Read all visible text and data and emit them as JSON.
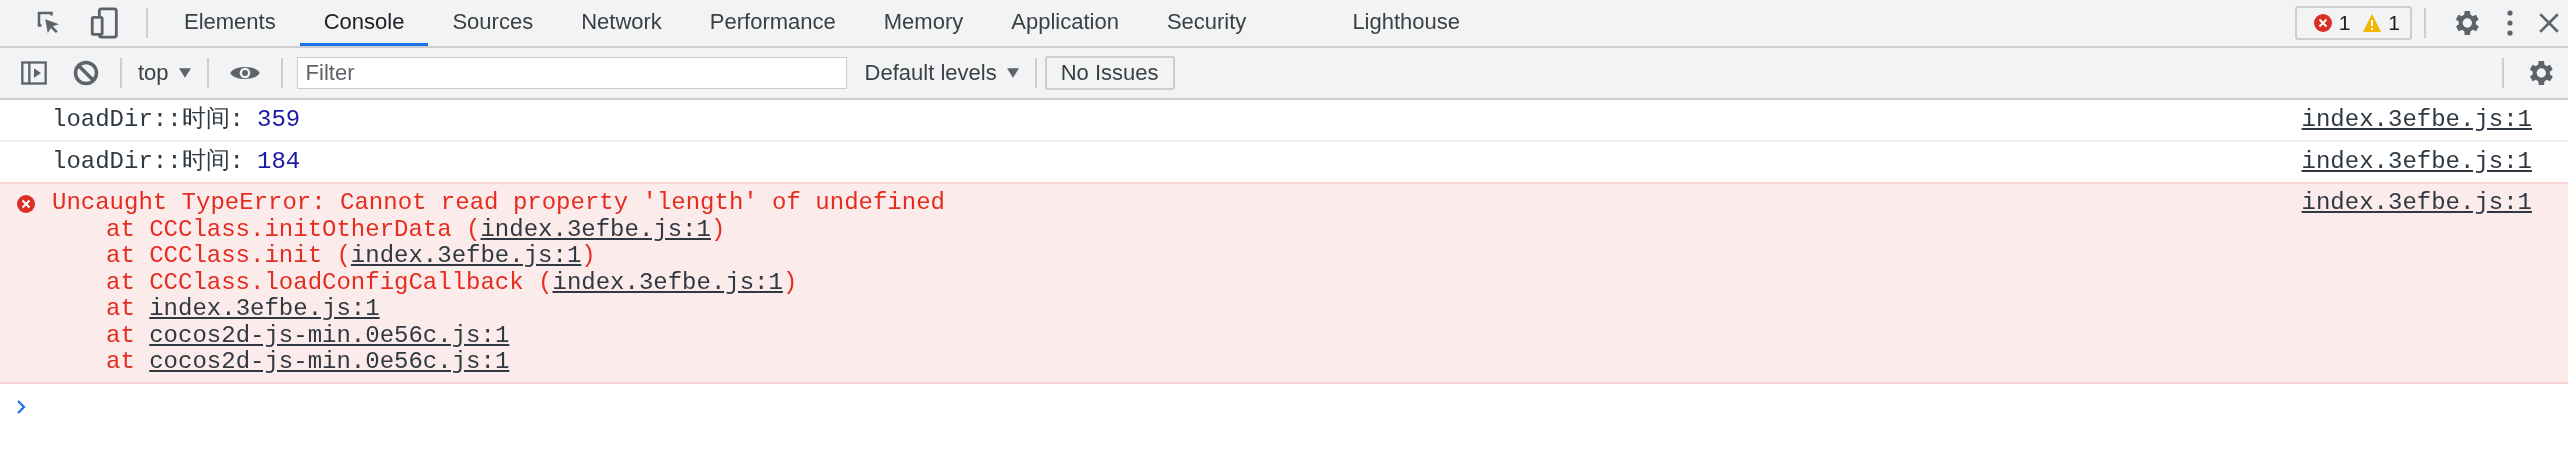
{
  "tabs": [
    {
      "label": "Elements",
      "selected": false
    },
    {
      "label": "Console",
      "selected": true
    },
    {
      "label": "Sources",
      "selected": false
    },
    {
      "label": "Network",
      "selected": false
    },
    {
      "label": "Performance",
      "selected": false
    },
    {
      "label": "Memory",
      "selected": false
    },
    {
      "label": "Application",
      "selected": false
    },
    {
      "label": "Security",
      "selected": false
    },
    {
      "label": "Lighthouse",
      "selected": false
    }
  ],
  "issue_counts": {
    "errors": "1",
    "warnings": "1"
  },
  "toolbar": {
    "context": "top",
    "filter_placeholder": "Filter",
    "levels": "Default levels",
    "issues": "No Issues"
  },
  "messages": [
    {
      "kind": "log",
      "text": "loadDir::时间:",
      "value": "359",
      "source": "index.3efbe.js:1"
    },
    {
      "kind": "log",
      "text": "loadDir::时间:",
      "value": "184",
      "source": "index.3efbe.js:1"
    },
    {
      "kind": "error",
      "text": "Uncaught TypeError: Cannot read property 'length' of undefined",
      "source": "index.3efbe.js:1",
      "stack": [
        {
          "text": "at CCClass.initOtherData (",
          "link": "index.3efbe.js:1",
          "after": ")"
        },
        {
          "text": "at CCClass.init (",
          "link": "index.3efbe.js:1",
          "after": ")"
        },
        {
          "text": "at CCClass.loadConfigCallback (",
          "link": "index.3efbe.js:1",
          "after": ")"
        },
        {
          "text": "at ",
          "link": "index.3efbe.js:1"
        },
        {
          "text": "at ",
          "link": "cocos2d-js-min.0e56c.js:1"
        },
        {
          "text": "at ",
          "link": "cocos2d-js-min.0e56c.js:1"
        }
      ]
    }
  ]
}
